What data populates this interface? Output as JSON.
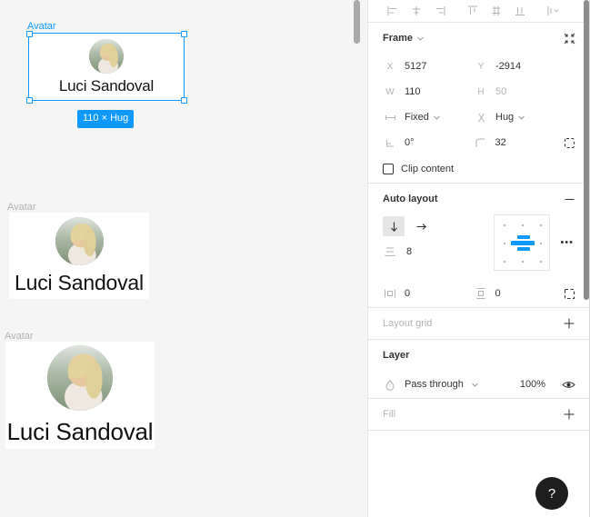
{
  "canvas": {
    "background_color": "#f5f5f5",
    "selection_color": "#0d99ff",
    "instances": [
      {
        "label": "Avatar",
        "name": "Luci Sandoval",
        "selected": true
      },
      {
        "label": "Avatar",
        "name": "Luci Sandoval",
        "selected": false
      },
      {
        "label": "Avatar",
        "name": "Luci Sandoval",
        "selected": false
      }
    ],
    "size_badge": "110 × Hug"
  },
  "panel": {
    "align_toolbar": {
      "buttons": [
        "align-left-icon",
        "align-horizontal-centers-icon",
        "align-right-icon",
        "align-top-icon",
        "align-vertical-centers-icon",
        "align-bottom-icon",
        "distribute-icon"
      ]
    },
    "frame": {
      "title": "Frame",
      "x_label": "X",
      "x_value": "5127",
      "y_label": "Y",
      "y_value": "-2914",
      "w_label": "W",
      "w_value": "110",
      "h_label": "H",
      "h_value": "50",
      "horizontal_resizing": "Fixed",
      "vertical_resizing": "Hug",
      "rotation": "0°",
      "corner_radius": "32",
      "clip_content_label": "Clip content",
      "clip_content_checked": false
    },
    "auto_layout": {
      "title": "Auto layout",
      "direction": "vertical",
      "gap": "8",
      "horizontal_padding": "0",
      "vertical_padding": "0",
      "alignment": "center",
      "more_label": "•••"
    },
    "layout_grid": {
      "title": "Layout grid"
    },
    "layer": {
      "title": "Layer",
      "blend_mode": "Pass through",
      "opacity": "100%"
    },
    "fill": {
      "title": "Fill"
    },
    "help_button": "?"
  }
}
